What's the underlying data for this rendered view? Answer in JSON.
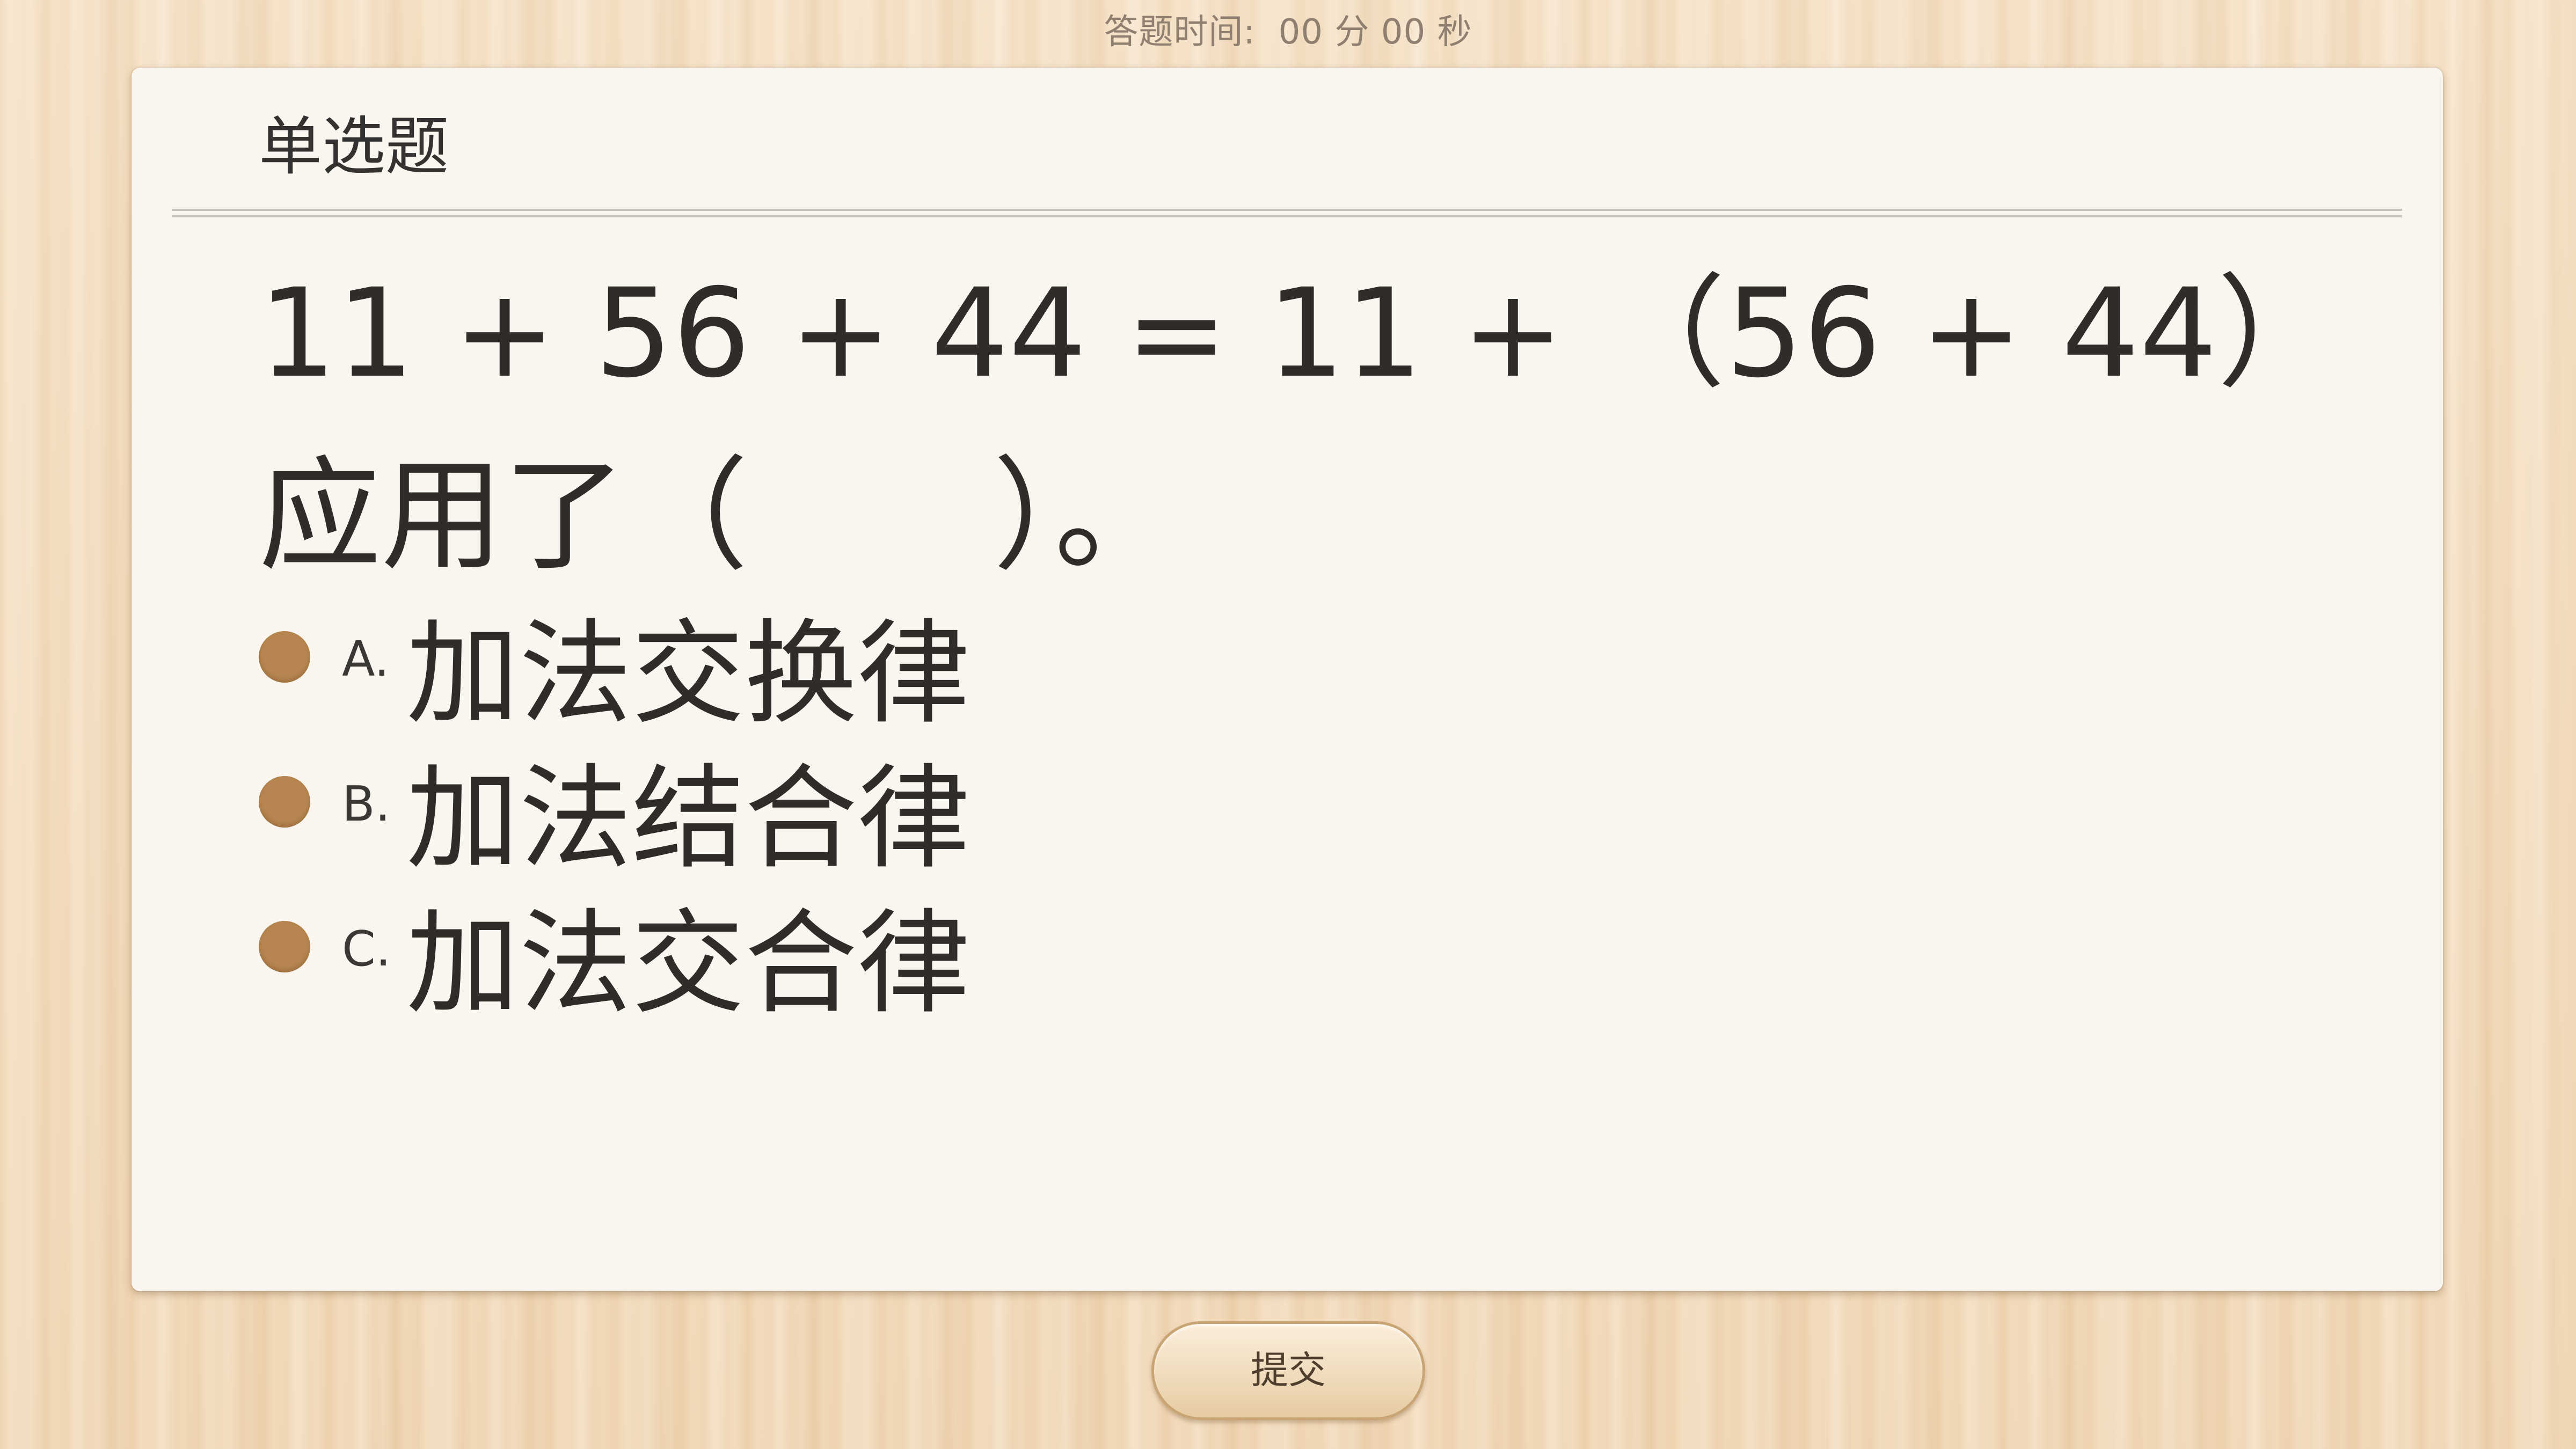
{
  "timer": {
    "label": "答题时间:",
    "minutes": "00",
    "minutes_unit": "分",
    "seconds": "00",
    "seconds_unit": "秒"
  },
  "card": {
    "section_title": "单选题",
    "question": "11 + 56 + 44 = 11 + （56 + 44）应用了（　　）。",
    "options": [
      {
        "letter": "A.",
        "text": "加法交换律"
      },
      {
        "letter": "B.",
        "text": "加法结合律"
      },
      {
        "letter": "C.",
        "text": "加法交合律"
      }
    ]
  },
  "submit": {
    "label": "提交"
  },
  "colors": {
    "option_dot": "#b78650",
    "card_background": "#faf6ef",
    "wood_background": "#f3dcbc"
  },
  "icons": {
    "option_marker": "radio-dot-icon"
  }
}
